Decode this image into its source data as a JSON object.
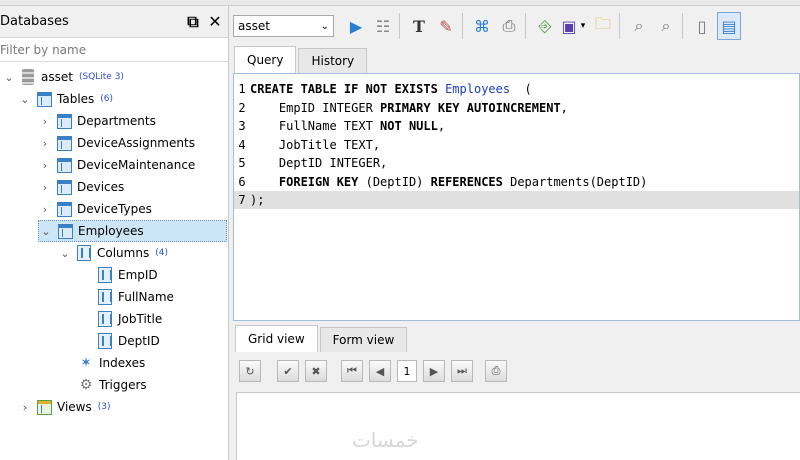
{
  "dock": {
    "title": "Databases",
    "filter_placeholder": "Filter by name",
    "tree": [
      {
        "label": "asset",
        "count": "(SQLite 3)"
      },
      {
        "label": "Tables",
        "count": "(6)"
      },
      {
        "label": "Departments"
      },
      {
        "label": "DeviceAssignments"
      },
      {
        "label": "DeviceMaintenance"
      },
      {
        "label": "Devices"
      },
      {
        "label": "DeviceTypes"
      },
      {
        "label": "Employees"
      },
      {
        "label": "Columns",
        "count": "(4)"
      },
      {
        "label": "EmpID"
      },
      {
        "label": "FullName"
      },
      {
        "label": "JobTitle"
      },
      {
        "label": "DeptID"
      },
      {
        "label": "Indexes"
      },
      {
        "label": "Triggers"
      },
      {
        "label": "Views",
        "count": "(3)"
      }
    ]
  },
  "toolbar": {
    "db_select": "asset"
  },
  "editor_tabs": [
    "Query",
    "History"
  ],
  "editor": {
    "lines": [
      {
        "n": "1",
        "parts": [
          [
            "kw",
            "CREATE TABLE IF NOT EXISTS "
          ],
          [
            "id",
            "Employees"
          ],
          [
            "",
            "  ("
          ]
        ]
      },
      {
        "n": "2",
        "parts": [
          [
            "",
            "    EmpID INTEGER "
          ],
          [
            "kw",
            "PRIMARY KEY AUTOINCREMENT"
          ],
          [
            "",
            ","
          ]
        ]
      },
      {
        "n": "3",
        "parts": [
          [
            "",
            "    FullName TEXT "
          ],
          [
            "kw",
            "NOT NULL"
          ],
          [
            "",
            ","
          ]
        ]
      },
      {
        "n": "4",
        "parts": [
          [
            "",
            "    JobTitle TEXT,"
          ]
        ]
      },
      {
        "n": "5",
        "parts": [
          [
            "",
            "    DeptID INTEGER,"
          ]
        ]
      },
      {
        "n": "6",
        "parts": [
          [
            "kw",
            "    FOREIGN KEY "
          ],
          [
            "",
            "(DeptID) "
          ],
          [
            "kw",
            "REFERENCES "
          ],
          [
            "",
            "Departments(DeptID)"
          ]
        ]
      },
      {
        "n": "7",
        "parts": [
          [
            "",
            ");"
          ]
        ]
      }
    ]
  },
  "result_tabs": [
    "Grid view",
    "Form view"
  ],
  "grid": {
    "page": "1"
  },
  "watermark": "خمسات"
}
